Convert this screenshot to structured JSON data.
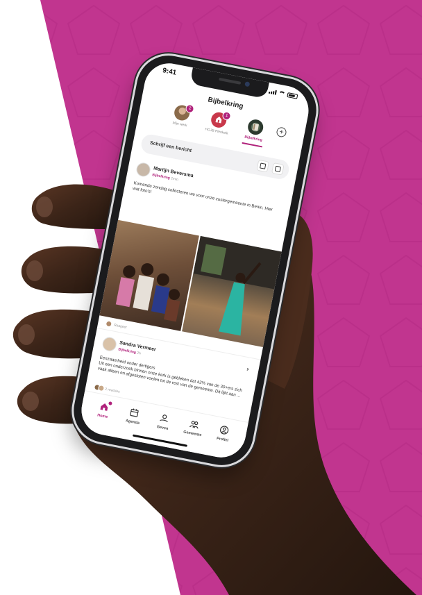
{
  "colors": {
    "brand": "#b0227b",
    "background_magenta": "#c1358f",
    "skin": "#3b2418",
    "phone_frame": "#1b1b1d"
  },
  "status_bar": {
    "time": "9:41"
  },
  "app": {
    "title": "Bijbelkring"
  },
  "groups": [
    {
      "label": "Mijn werk",
      "badge": "2",
      "icon": "avatar-person",
      "color": "#8a6a4a",
      "active": false
    },
    {
      "label": "HGJB Plenkelk",
      "badge": "1",
      "icon": "church-logo",
      "color": "#c8384a",
      "active": false
    },
    {
      "label": "Bijbelkring",
      "badge": "",
      "icon": "bible-book",
      "color": "#2c3a2e",
      "active": true
    }
  ],
  "add_group_icon": "plus-circle-icon",
  "compose": {
    "placeholder": "Schrijf een bericht",
    "icons": [
      "document-icon",
      "image-icon"
    ]
  },
  "posts": [
    {
      "author": "Martijn Beversma",
      "group": "Bijbelkring",
      "time": "2min",
      "text": "Komende zondag collecteren we voor onze zustergemeente in Benin. Hier wat foto's!",
      "reply_label": "Reageer"
    },
    {
      "author": "Sandra Vermeer",
      "group": "Bijbelkring",
      "time": "2h",
      "text": "Eenzaamheid onder dertigers\nUit een onderzoek binnen onze kerk is gebleken dat 42% van de 30+ers zich vaak alleen en afgesloten voelen tot de rest van de gemeente. Dit lijkt aan ...",
      "reactions_label": "2 reacties"
    }
  ],
  "tabbar": [
    {
      "label": "Home",
      "icon": "home-icon",
      "active": true
    },
    {
      "label": "Agenda",
      "icon": "calendar-icon",
      "active": false
    },
    {
      "label": "Geven",
      "icon": "giving-hand-icon",
      "active": false
    },
    {
      "label": "Gemeente",
      "icon": "community-icon",
      "active": false
    },
    {
      "label": "Profiel",
      "icon": "profile-icon",
      "active": false
    }
  ]
}
